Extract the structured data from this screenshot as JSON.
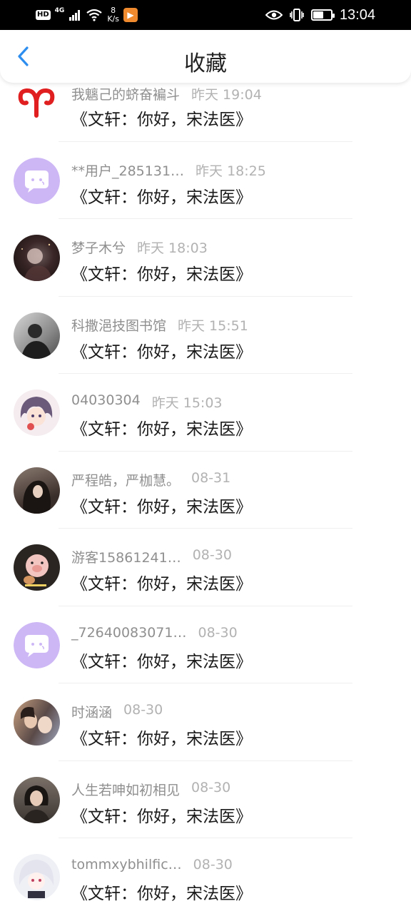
{
  "status_bar": {
    "hd": "HD",
    "network": "4G",
    "speed_value": "8",
    "speed_unit": "K/s",
    "battery": "51",
    "time": "13:04"
  },
  "header": {
    "title": "收藏",
    "back_icon": "chevron-left-icon"
  },
  "colors": {
    "accent": "#2d8ef0",
    "lavender": "#cdb7f5",
    "aries": "#e02020"
  },
  "items": [
    {
      "user": "我魑己的蛴奋褊斗",
      "time": "昨天 19:04",
      "title": "《文轩：你好，宋法医》",
      "avatar": "aries-icon"
    },
    {
      "user": "**用户_285131…",
      "time": "昨天 18:25",
      "title": "《文轩：你好，宋法医》",
      "avatar": "chat-bubble-icon"
    },
    {
      "user": "梦子木兮",
      "time": "昨天 18:03",
      "title": "《文轩：你好，宋法医》",
      "avatar": "photo-avatar"
    },
    {
      "user": "科撒浥技图书馆",
      "time": "昨天 15:51",
      "title": "《文轩：你好，宋法医》",
      "avatar": "photo-avatar"
    },
    {
      "user": "04030304",
      "time": "昨天 15:03",
      "title": "《文轩：你好，宋法医》",
      "avatar": "anime-avatar"
    },
    {
      "user": "严程皓，严枷慧。",
      "time": "08-31",
      "title": "《文轩：你好，宋法医》",
      "avatar": "photo-avatar"
    },
    {
      "user": "游客15861241…",
      "time": "08-30",
      "title": "《文轩：你好，宋法医》",
      "avatar": "pig-avatar"
    },
    {
      "user": "_72640083071…",
      "time": "08-30",
      "title": "《文轩：你好，宋法医》",
      "avatar": "chat-bubble-icon"
    },
    {
      "user": "时涵涵",
      "time": "08-30",
      "title": "《文轩：你好，宋法医》",
      "avatar": "photo-avatar"
    },
    {
      "user": "人生若呻如初相见",
      "time": "08-30",
      "title": "《文轩：你好，宋法医》",
      "avatar": "photo-avatar"
    },
    {
      "user": "tommxybhilfic…",
      "time": "08-30",
      "title": "《文轩：你好，宋法医》",
      "avatar": "anime-avatar"
    }
  ]
}
